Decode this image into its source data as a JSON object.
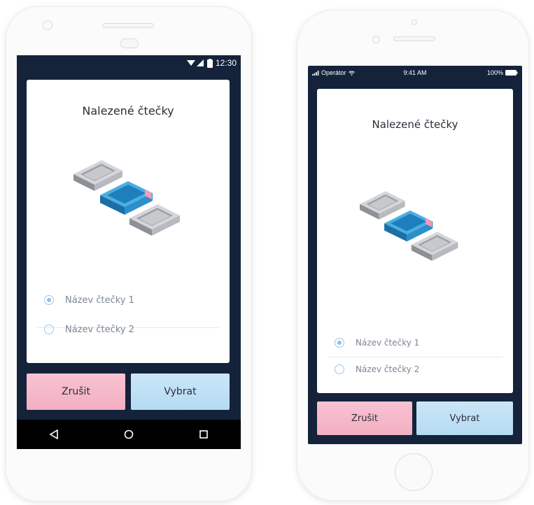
{
  "android": {
    "status_time": "12:30",
    "dialog_title": "Nalezené čtečky",
    "readers": [
      {
        "label": "Název čtečky 1",
        "selected": true
      },
      {
        "label": "Název čtečky 2",
        "selected": false
      }
    ],
    "cancel_label": "Zrušit",
    "select_label": "Vybrat",
    "nav_icons": [
      "back-triangle-icon",
      "home-circle-icon",
      "recents-square-icon"
    ]
  },
  "iphone": {
    "carrier": "Operátor",
    "status_time": "9:41 AM",
    "battery": "100%",
    "dialog_title": "Nalezené čtečky",
    "readers": [
      {
        "label": "Název čtečky 1",
        "selected": true
      },
      {
        "label": "Název čtečky 2",
        "selected": false
      }
    ],
    "cancel_label": "Zrušit",
    "select_label": "Vybrat"
  },
  "colors": {
    "screen_bg": "#14233a",
    "radio_accent": "#8ec0eb",
    "cancel_button": "#f2afc2",
    "select_button": "#b4dbf4",
    "reader_highlight": "#2b8fc9"
  }
}
